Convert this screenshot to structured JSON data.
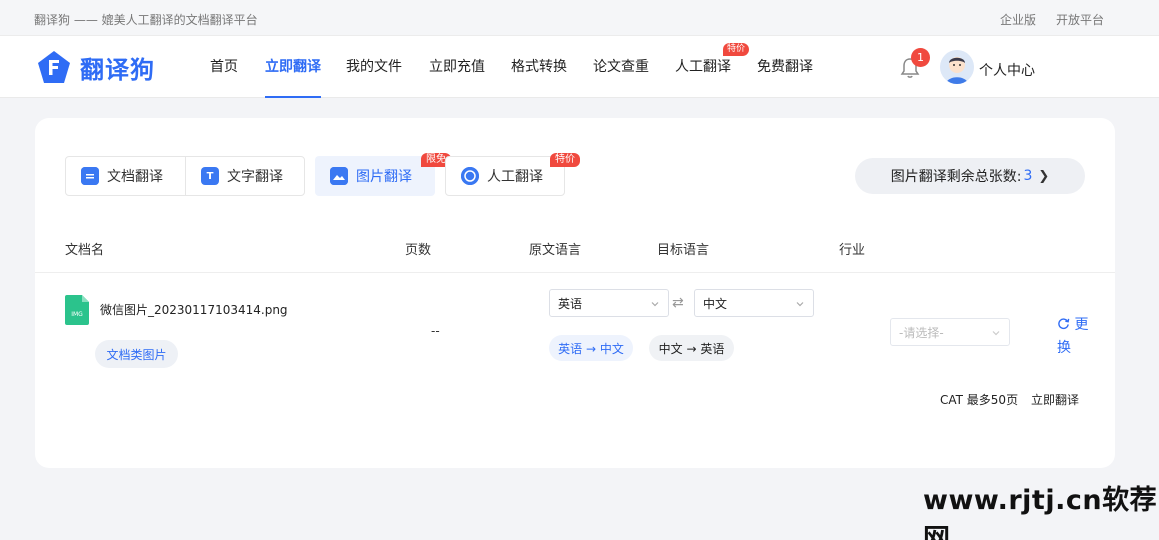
{
  "topbar": {
    "slogan": "翻译狗 —— 媲美人工翻译的文档翻译平台",
    "links": [
      "企业版",
      "开放平台"
    ]
  },
  "header": {
    "logo_text": "翻译狗",
    "nav": [
      {
        "label": "首页"
      },
      {
        "label": "立即翻译",
        "active": true
      },
      {
        "label": "我的文件"
      },
      {
        "label": "立即充值"
      },
      {
        "label": "格式转换"
      },
      {
        "label": "论文查重"
      },
      {
        "label": "人工翻译",
        "badge": "特价"
      },
      {
        "label": "免费翻译"
      }
    ],
    "notification_count": "1",
    "user_label": "个人中心"
  },
  "tabs": [
    {
      "label": "文档翻译",
      "icon": "document-icon"
    },
    {
      "label": "文字翻译",
      "icon": "text-icon"
    },
    {
      "label": "图片翻译",
      "icon": "image-icon",
      "active": true,
      "badge": "限免"
    },
    {
      "label": "人工翻译",
      "icon": "chat-icon",
      "badge": "特价"
    }
  ],
  "quota": {
    "label": "图片翻译剩余总张数:",
    "value": "3"
  },
  "table": {
    "headers": [
      "文档名",
      "页数",
      "原文语言",
      "目标语言",
      "行业"
    ]
  },
  "file": {
    "name": "微信图片_20230117103414.png",
    "icon_text": "IMG",
    "tag": "文档类图片",
    "pages": "--",
    "source_language": "英语",
    "target_language": "中文",
    "direction_options": [
      "英语 → 中文",
      "中文 → 英语"
    ],
    "industry_placeholder": "-请选择-",
    "change_label": "更换"
  },
  "footer": {
    "cat_note": "CAT 最多50页",
    "translate_label": "立即翻译"
  },
  "watermark": "www.rjtj.cn软荐网",
  "colors": {
    "accent": "#2f6cf5",
    "badge": "#f0493e",
    "file_green": "#2bc38c"
  }
}
